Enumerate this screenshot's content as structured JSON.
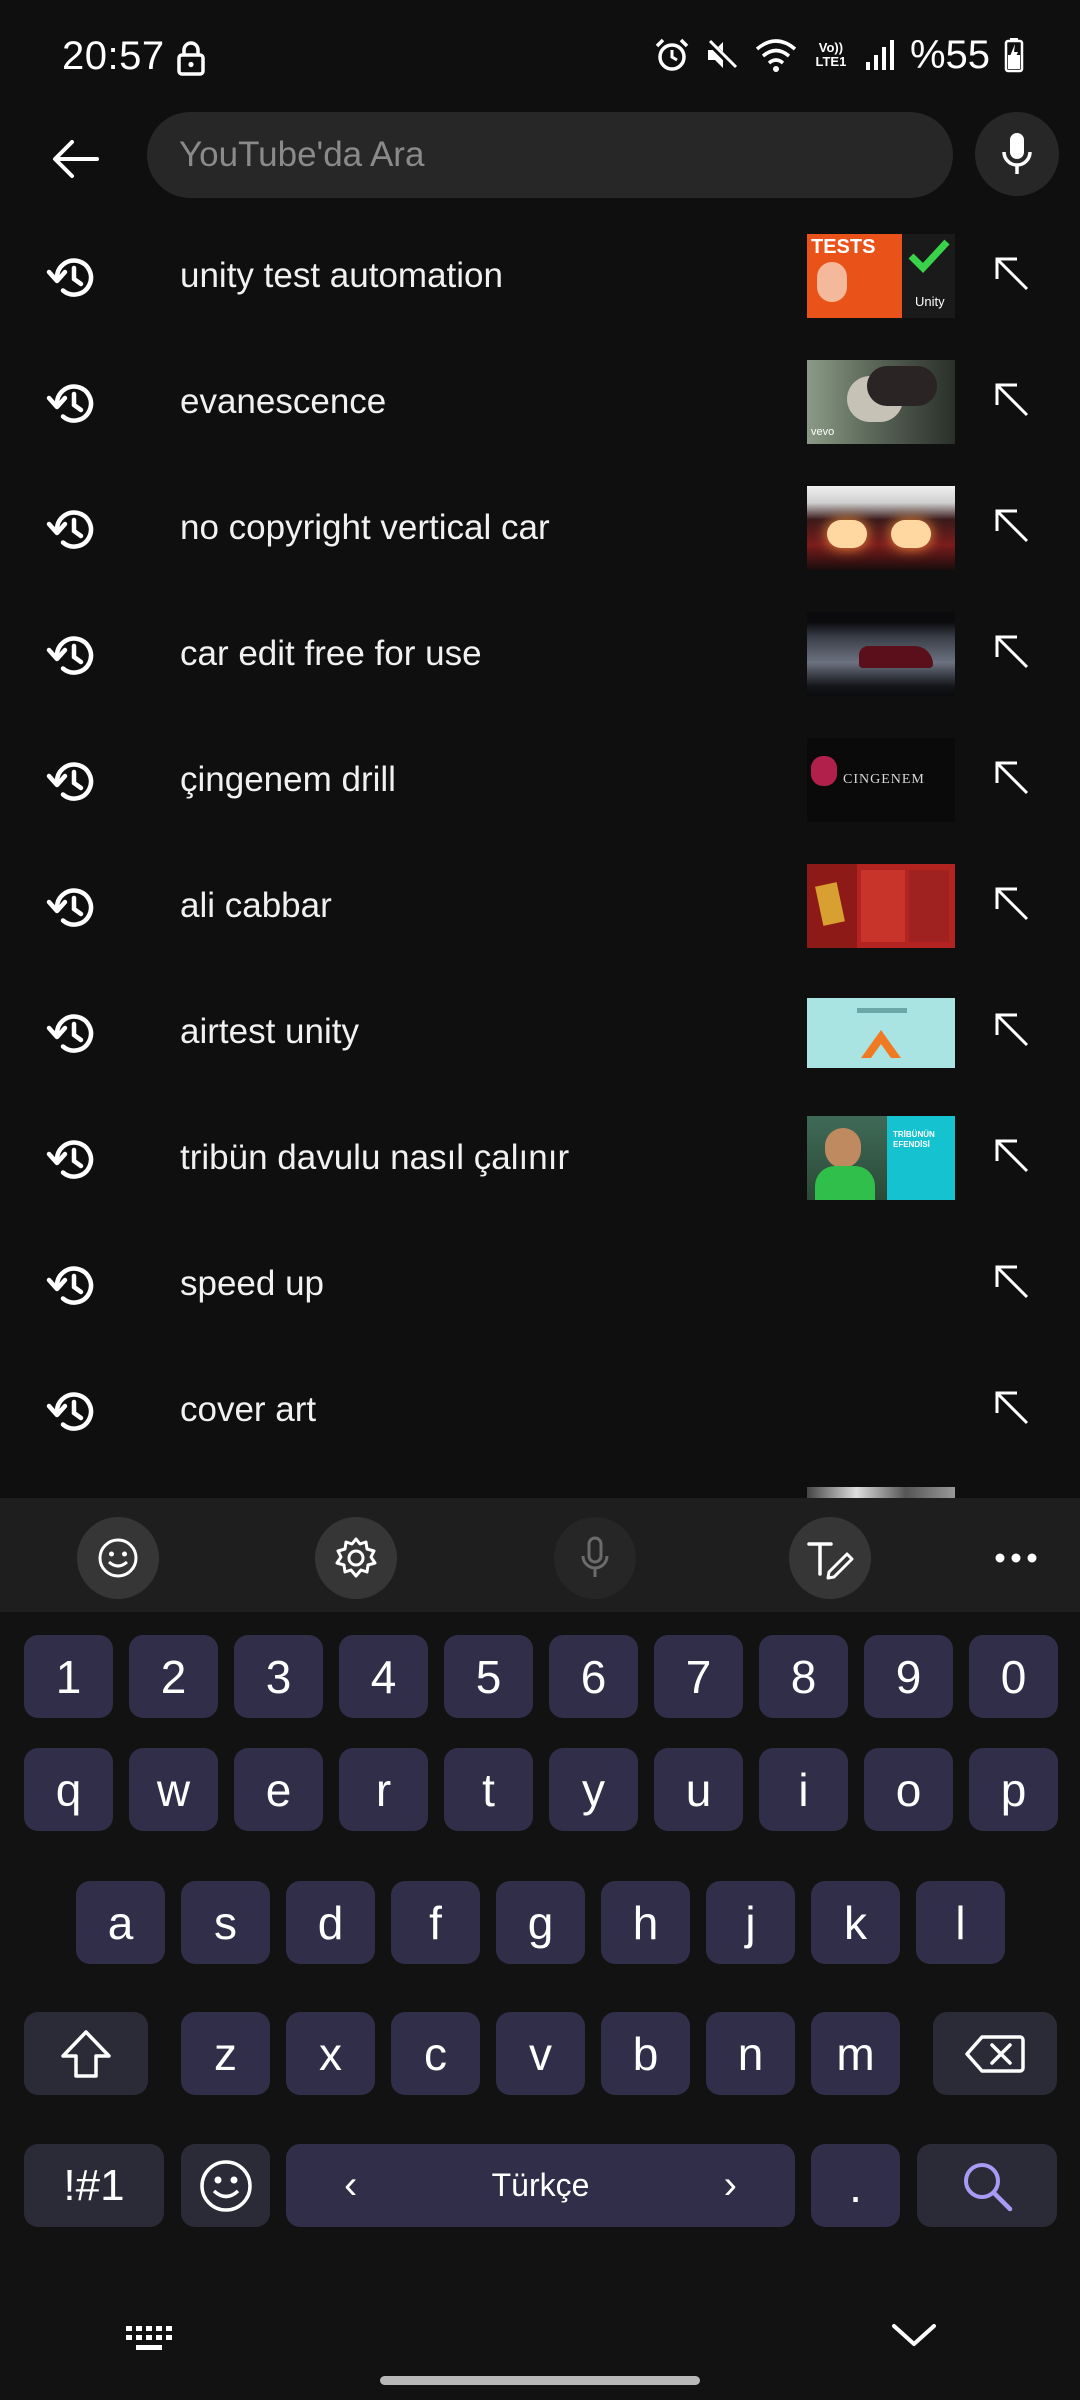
{
  "status_bar": {
    "time": "20:57",
    "network_label": "Vo)) LTE1",
    "battery": "%55"
  },
  "search": {
    "placeholder": "YouTube'da Ara",
    "value": ""
  },
  "suggestions": [
    {
      "text": "unity test automation",
      "has_thumbnail": true
    },
    {
      "text": "evanescence",
      "has_thumbnail": true
    },
    {
      "text": "no copyright vertical car",
      "has_thumbnail": true
    },
    {
      "text": "car edit free for use",
      "has_thumbnail": true
    },
    {
      "text": "çingenem drill",
      "has_thumbnail": true
    },
    {
      "text": "ali cabbar",
      "has_thumbnail": true
    },
    {
      "text": "airtest unity",
      "has_thumbnail": true
    },
    {
      "text": "tribün davulu nasıl çalınır",
      "has_thumbnail": true
    },
    {
      "text": "speed up",
      "has_thumbnail": false
    },
    {
      "text": "cover art",
      "has_thumbnail": false
    }
  ],
  "thumbnails": {
    "t1_title": "TESTS",
    "t1_brand": "Unity",
    "t2_label": "vevo",
    "t5_label": "CINGENEM",
    "t8_label": "TRİBÜNÜN EFENDİSİ"
  },
  "keyboard": {
    "number_row": [
      "1",
      "2",
      "3",
      "4",
      "5",
      "6",
      "7",
      "8",
      "9",
      "0"
    ],
    "row1": [
      "q",
      "w",
      "e",
      "r",
      "t",
      "y",
      "u",
      "i",
      "o",
      "p"
    ],
    "row2": [
      "a",
      "s",
      "d",
      "f",
      "g",
      "h",
      "j",
      "k",
      "l"
    ],
    "row3": [
      "z",
      "x",
      "c",
      "v",
      "b",
      "n",
      "m"
    ],
    "symbols_label": "!#1",
    "language_label": "Türkçe",
    "period_label": ".",
    "chevron_left": "‹",
    "chevron_right": "›"
  },
  "colors": {
    "background": "#0f0f0f",
    "search_box": "#272727",
    "key": "#302e48",
    "toolbar": "#1e1e1e",
    "search_key_icon": "#a89af5"
  },
  "icons": [
    "lock-icon",
    "alarm-icon",
    "mute-icon",
    "wifi-icon",
    "signal-icon",
    "battery-icon",
    "back-arrow-icon",
    "microphone-icon",
    "history-icon",
    "fill-query-arrow-icon",
    "emoji-icon",
    "settings-icon",
    "handwriting-icon",
    "more-icon",
    "shift-icon",
    "backspace-icon",
    "search-icon",
    "keyboard-icon",
    "chevron-down-icon"
  ]
}
